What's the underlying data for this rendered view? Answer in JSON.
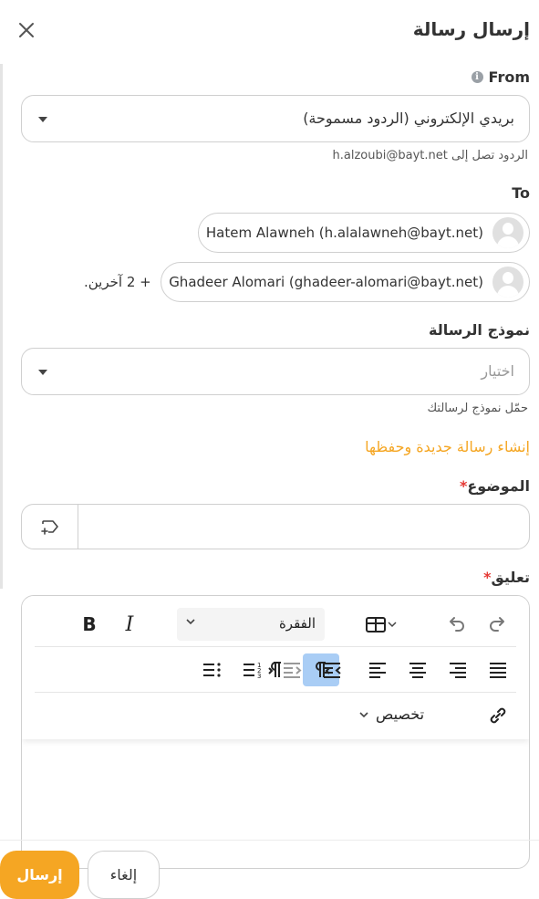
{
  "header": {
    "title": "إرسال رسالة"
  },
  "from": {
    "label": "From",
    "selected": "بريدي الإلكتروني (الردود مسموحة)",
    "hint": "الردود تصل إلى h.alzoubi@bayt.net"
  },
  "to": {
    "label": "To",
    "recipients": [
      {
        "name": "Hatem Alawneh (h.alalawneh@bayt.net)"
      },
      {
        "name": "Ghadeer Alomari (ghadeer-alomari@bayt.net)"
      }
    ],
    "more": "+ 2 آخرين."
  },
  "template": {
    "label": "نموذج الرسالة",
    "placeholder": "اختيار",
    "hint": "حمّل نموذج لرسالتك",
    "create_link": "إنشاء رسالة جديدة وحفظها"
  },
  "subject": {
    "label": "الموضوع",
    "required_mark": "*",
    "value": ""
  },
  "comment": {
    "label": "تعليق",
    "required_mark": "*",
    "paragraph_select": "الفقرة",
    "customize": "تخصيص",
    "bold": "B",
    "italic": "I"
  },
  "footer": {
    "send": "إرسال",
    "cancel": "إلغاء"
  },
  "colors": {
    "accent": "#f5a623",
    "active_tool": "#a9cdf5",
    "required": "#e53935"
  }
}
